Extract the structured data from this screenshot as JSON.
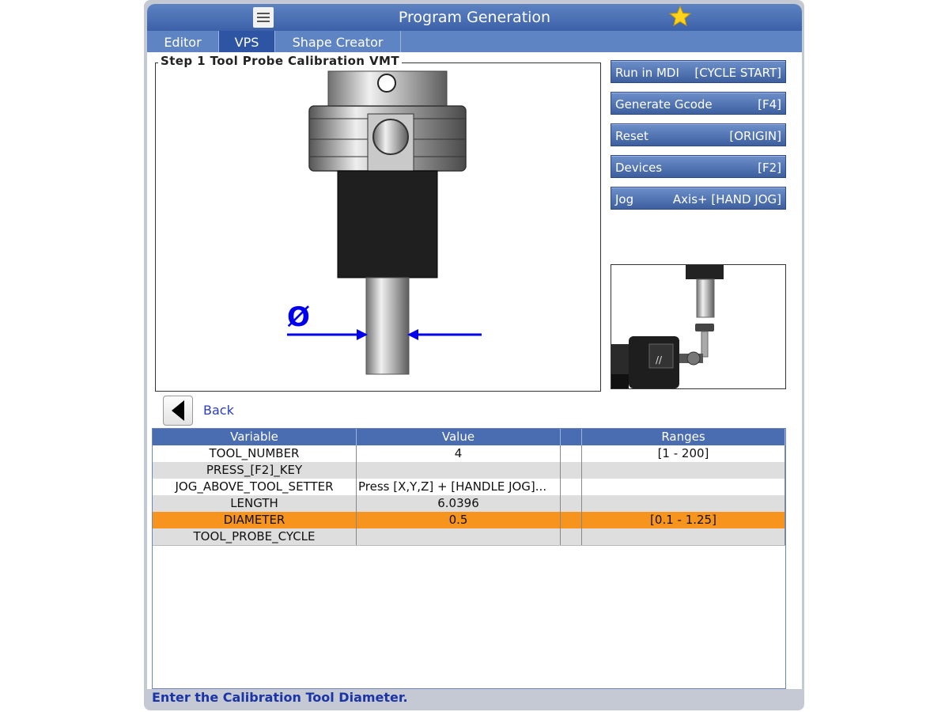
{
  "window": {
    "title": "Program Generation"
  },
  "tabs": [
    {
      "label": "Editor"
    },
    {
      "label": "VPS"
    },
    {
      "label": "Shape Creator"
    }
  ],
  "step": {
    "title": "Step 1 Tool Probe Calibration VMT"
  },
  "buttons": [
    {
      "label": "Run in MDI",
      "key": "[CYCLE START]"
    },
    {
      "label": "Generate Gcode",
      "key": "[F4]"
    },
    {
      "label": "Reset",
      "key": "[ORIGIN]"
    },
    {
      "label": "Devices",
      "key": "[F2]"
    },
    {
      "label": "Jog",
      "key": "Axis+ [HAND JOG]"
    }
  ],
  "back": {
    "label": "Back"
  },
  "table": {
    "headers": [
      "Variable",
      "Value",
      "",
      "Ranges"
    ],
    "rows": [
      {
        "variable": "TOOL_NUMBER",
        "value": "4",
        "range": "[1 - 200]"
      },
      {
        "variable": "PRESS_[F2]_KEY",
        "value": "",
        "range": ""
      },
      {
        "variable": "JOG_ABOVE_TOOL_SETTER",
        "value": "Press [X,Y,Z] + [HANDLE JOG]...",
        "range": ""
      },
      {
        "variable": "LENGTH",
        "value": "6.0396",
        "range": ""
      },
      {
        "variable": "DIAMETER",
        "value": "0.5",
        "range": "[0.1 - 1.25]"
      },
      {
        "variable": "TOOL_PROBE_CYCLE",
        "value": "",
        "range": ""
      }
    ],
    "selected_row": 4
  },
  "diagram": {
    "diameter_symbol": "Ø"
  },
  "status": {
    "message": "Enter the Calibration Tool Diameter."
  },
  "colors": {
    "accent": "#3c61a8",
    "selected_row": "#f7941d",
    "status_text": "#1c35a6",
    "arrow": "#0000ee"
  }
}
